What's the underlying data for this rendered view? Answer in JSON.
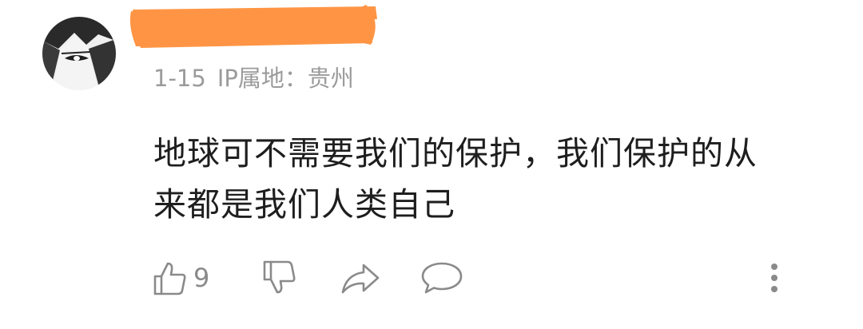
{
  "comment": {
    "avatar_icon": "manga-character-avatar",
    "username_redacted": true,
    "redaction_color": "#ff9544",
    "date": "1-15",
    "ip_location": "IP属地：贵州",
    "text_line1": "地球可不需要我们的保护，我们保护的从",
    "text_line2": "来都是我们人类自己",
    "actions": {
      "like_icon": "thumbs-up-icon",
      "like_count": "9",
      "dislike_icon": "thumbs-down-icon",
      "share_icon": "share-arrow-icon",
      "reply_icon": "speech-bubble-icon",
      "more_icon": "vertical-dots-icon"
    }
  }
}
